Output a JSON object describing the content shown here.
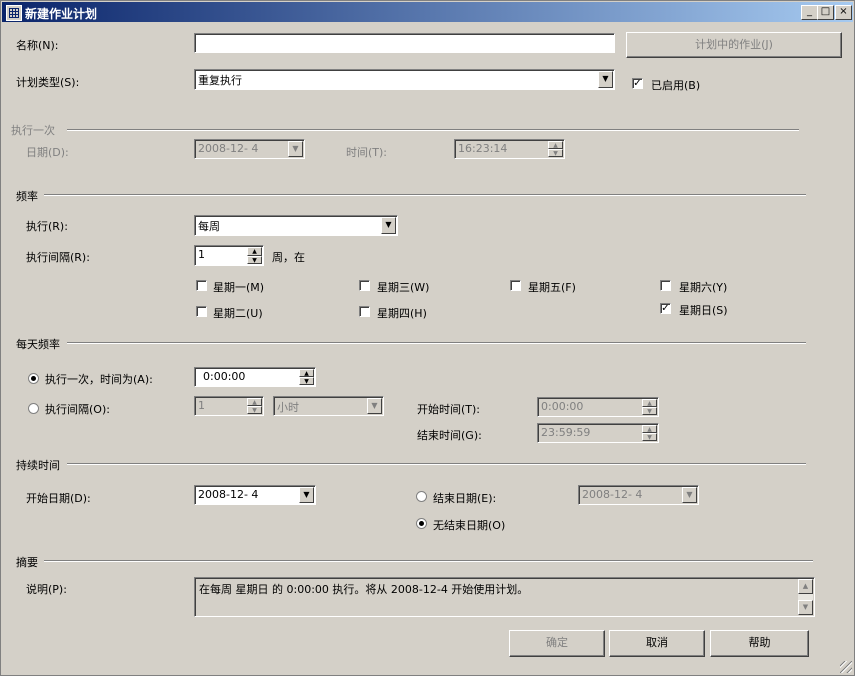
{
  "window": {
    "title": "新建作业计划",
    "min": "_",
    "max": "□",
    "close": "×"
  },
  "name": {
    "label": "名称(N):",
    "value": "",
    "jobs_button": "计划中的作业(J)"
  },
  "schedule_type": {
    "label": "计划类型(S):",
    "value": "重复执行",
    "enabled_label": "已启用(B)",
    "enabled": true
  },
  "once": {
    "header": "执行一次",
    "date_label": "日期(D):",
    "date_value": "2008-12- 4",
    "time_label": "时间(T):",
    "time_value": "16:23:14"
  },
  "frequency": {
    "header": "频率",
    "occurs_label": "执行(R):",
    "occurs_value": "每周",
    "recur_label": "执行间隔(R):",
    "recur_value": "1",
    "recur_unit": "周，在",
    "days": [
      {
        "label": "星期一(M)",
        "checked": false
      },
      {
        "label": "星期三(W)",
        "checked": false
      },
      {
        "label": "星期五(F)",
        "checked": false
      },
      {
        "label": "星期六(Y)",
        "checked": false
      },
      {
        "label": "星期二(U)",
        "checked": false
      },
      {
        "label": "星期四(H)",
        "checked": false
      },
      {
        "label": "星期日(S)",
        "checked": true
      }
    ]
  },
  "daily": {
    "header": "每天频率",
    "once_label": "执行一次，时间为(A):",
    "once_value": "0:00:00",
    "every_label": "执行间隔(O):",
    "every_value": "1",
    "every_unit": "小时",
    "start_label": "开始时间(T):",
    "start_value": "0:00:00",
    "end_label": "结束时间(G):",
    "end_value": "23:59:59",
    "selected": "once"
  },
  "duration": {
    "header": "持续时间",
    "start_label": "开始日期(D):",
    "start_value": "2008-12- 4",
    "end_label": "结束日期(E):",
    "end_value": "2008-12- 4",
    "no_end_label": "无结束日期(O)",
    "selected": "no_end"
  },
  "summary": {
    "header": "摘要",
    "desc_label": "说明(P):",
    "desc_value": "在每周 星期日 的 0:00:00 执行。将从 2008-12-4 开始使用计划。"
  },
  "buttons": {
    "ok": "确定",
    "cancel": "取消",
    "help": "帮助"
  },
  "icons": {
    "window": "grid-icon",
    "check": "check-icon",
    "dropdown": "chevron-down-icon"
  }
}
